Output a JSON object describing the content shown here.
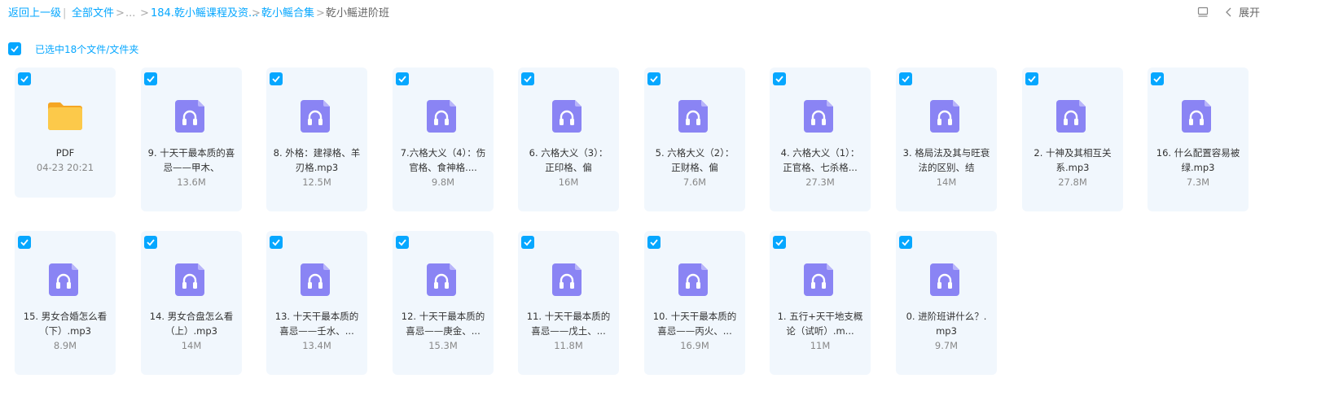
{
  "breadcrumb": {
    "back": "返回上一级",
    "all_files": "全部文件",
    "ellipsis": "...",
    "folder1": "184.乾小鳐课程及资...",
    "folder2": "乾小鳐合集",
    "current": "乾小鳐进阶班"
  },
  "toolbar": {
    "expand_label": "展开"
  },
  "selection": {
    "text": "已选中18个文件/文件夹"
  },
  "items": [
    {
      "type": "folder",
      "name": "PDF",
      "meta": "04-23 20:21"
    },
    {
      "type": "audio",
      "name": "9. 十天干最本质的喜忌——甲木、",
      "meta": "13.6M"
    },
    {
      "type": "audio",
      "name": "8. 外格：建禄格、羊刃格.mp3",
      "meta": "12.5M"
    },
    {
      "type": "audio",
      "name": "7.六格大义（4）：伤官格、食神格....",
      "meta": "9.8M"
    },
    {
      "type": "audio",
      "name": "6. 六格大义（3）：正印格、偏",
      "meta": "16M"
    },
    {
      "type": "audio",
      "name": "5. 六格大义（2）：正财格、偏",
      "meta": "7.6M"
    },
    {
      "type": "audio",
      "name": "4. 六格大义（1）：正官格、七杀格...",
      "meta": "27.3M"
    },
    {
      "type": "audio",
      "name": "3. 格局法及其与旺衰法的区别、结",
      "meta": "14M"
    },
    {
      "type": "audio",
      "name": "2. 十神及其相互关系.mp3",
      "meta": "27.8M"
    },
    {
      "type": "audio",
      "name": "16. 什么配置容易被绿.mp3",
      "meta": "7.3M"
    },
    {
      "type": "audio",
      "name": "15. 男女合婚怎么看（下）.mp3",
      "meta": "8.9M"
    },
    {
      "type": "audio",
      "name": "14. 男女合盘怎么看（上）.mp3",
      "meta": "14M"
    },
    {
      "type": "audio",
      "name": "13. 十天干最本质的喜忌——壬水、...",
      "meta": "13.4M"
    },
    {
      "type": "audio",
      "name": "12. 十天干最本质的喜忌——庚金、...",
      "meta": "15.3M"
    },
    {
      "type": "audio",
      "name": "11. 十天干最本质的喜忌——戊土、...",
      "meta": "11.8M"
    },
    {
      "type": "audio",
      "name": "10. 十天干最本质的喜忌——丙火、...",
      "meta": "16.9M"
    },
    {
      "type": "audio",
      "name": "1. 五行+天干地支概论（试听）.m...",
      "meta": "11M"
    },
    {
      "type": "audio",
      "name": "0. 进阶班讲什么？.mp3",
      "meta": "9.7M"
    }
  ],
  "colors": {
    "accent": "#06a7ff",
    "card_bg": "#f1f7fd",
    "audio_icon": "#8a84f4",
    "folder": "#fbc02d"
  }
}
